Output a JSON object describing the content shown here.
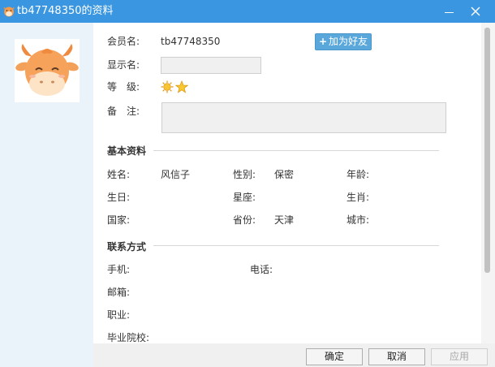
{
  "window": {
    "title": "tb47748350的资料",
    "minimize_icon": "minimize-icon",
    "close_icon": "close-icon",
    "titlebar_color": "#3a96e0"
  },
  "profile": {
    "member_label": "会员名:",
    "member_value": "tb47748350",
    "add_friend_label": "加为好友",
    "display_name_label": "显示名:",
    "display_name_value": "",
    "level_label": "等　级:",
    "level_icons": [
      "sun-icon",
      "star-icon"
    ],
    "remark_label": "备　注:",
    "remark_value": ""
  },
  "basic": {
    "section_title": "基本资料",
    "fields": [
      {
        "label": "姓名:",
        "value": "风信子"
      },
      {
        "label": "性别:",
        "value": "保密"
      },
      {
        "label": "年龄:",
        "value": ""
      },
      {
        "label": "生日:",
        "value": ""
      },
      {
        "label": "星座:",
        "value": ""
      },
      {
        "label": "生肖:",
        "value": ""
      },
      {
        "label": "国家:",
        "value": ""
      },
      {
        "label": "省份:",
        "value": "天津"
      },
      {
        "label": "城市:",
        "value": ""
      }
    ]
  },
  "contact": {
    "section_title": "联系方式",
    "fields": [
      {
        "label": "手机:",
        "value": ""
      },
      {
        "label": "电话:",
        "value": ""
      },
      {
        "label": "邮箱:",
        "value": ""
      },
      {
        "label": "职业:",
        "value": ""
      },
      {
        "label": "毕业院校:",
        "value": ""
      }
    ]
  },
  "buttons": {
    "ok": "确定",
    "cancel": "取消",
    "apply": "应用"
  }
}
